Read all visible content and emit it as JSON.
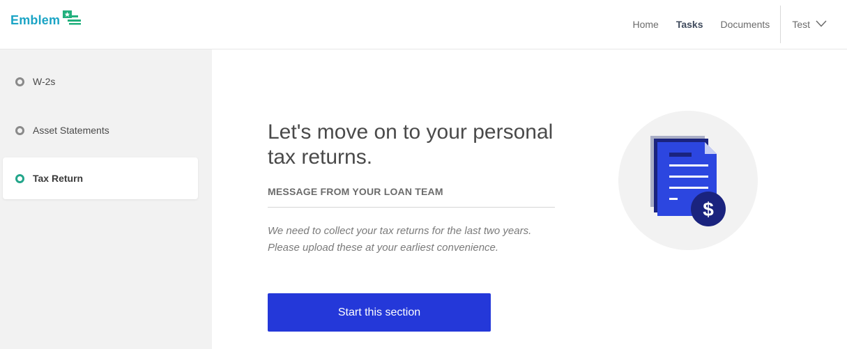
{
  "brand": {
    "name": "Emblem",
    "accent": "#1ba4c5",
    "mark_color": "#22b07d"
  },
  "nav": {
    "items": [
      {
        "label": "Home",
        "active": false
      },
      {
        "label": "Tasks",
        "active": true
      },
      {
        "label": "Documents",
        "active": false
      }
    ],
    "user": {
      "name": "Test",
      "icon": "chevron-down-icon"
    }
  },
  "sidebar": {
    "items": [
      {
        "label": "W-2s",
        "active": false
      },
      {
        "label": "Asset Statements",
        "active": false
      },
      {
        "label": "Tax Return",
        "active": true
      }
    ],
    "active_color": "#22a58a"
  },
  "main": {
    "headline": "Let's move on to your personal tax returns.",
    "section_label": "MESSAGE FROM YOUR LOAN TEAM",
    "message": "We need to collect your tax returns for the last two years. Please upload these at your earliest convenience.",
    "button_label": "Start this section",
    "button_color": "#2438d9",
    "illustration": "tax-document-dollar-icon"
  }
}
